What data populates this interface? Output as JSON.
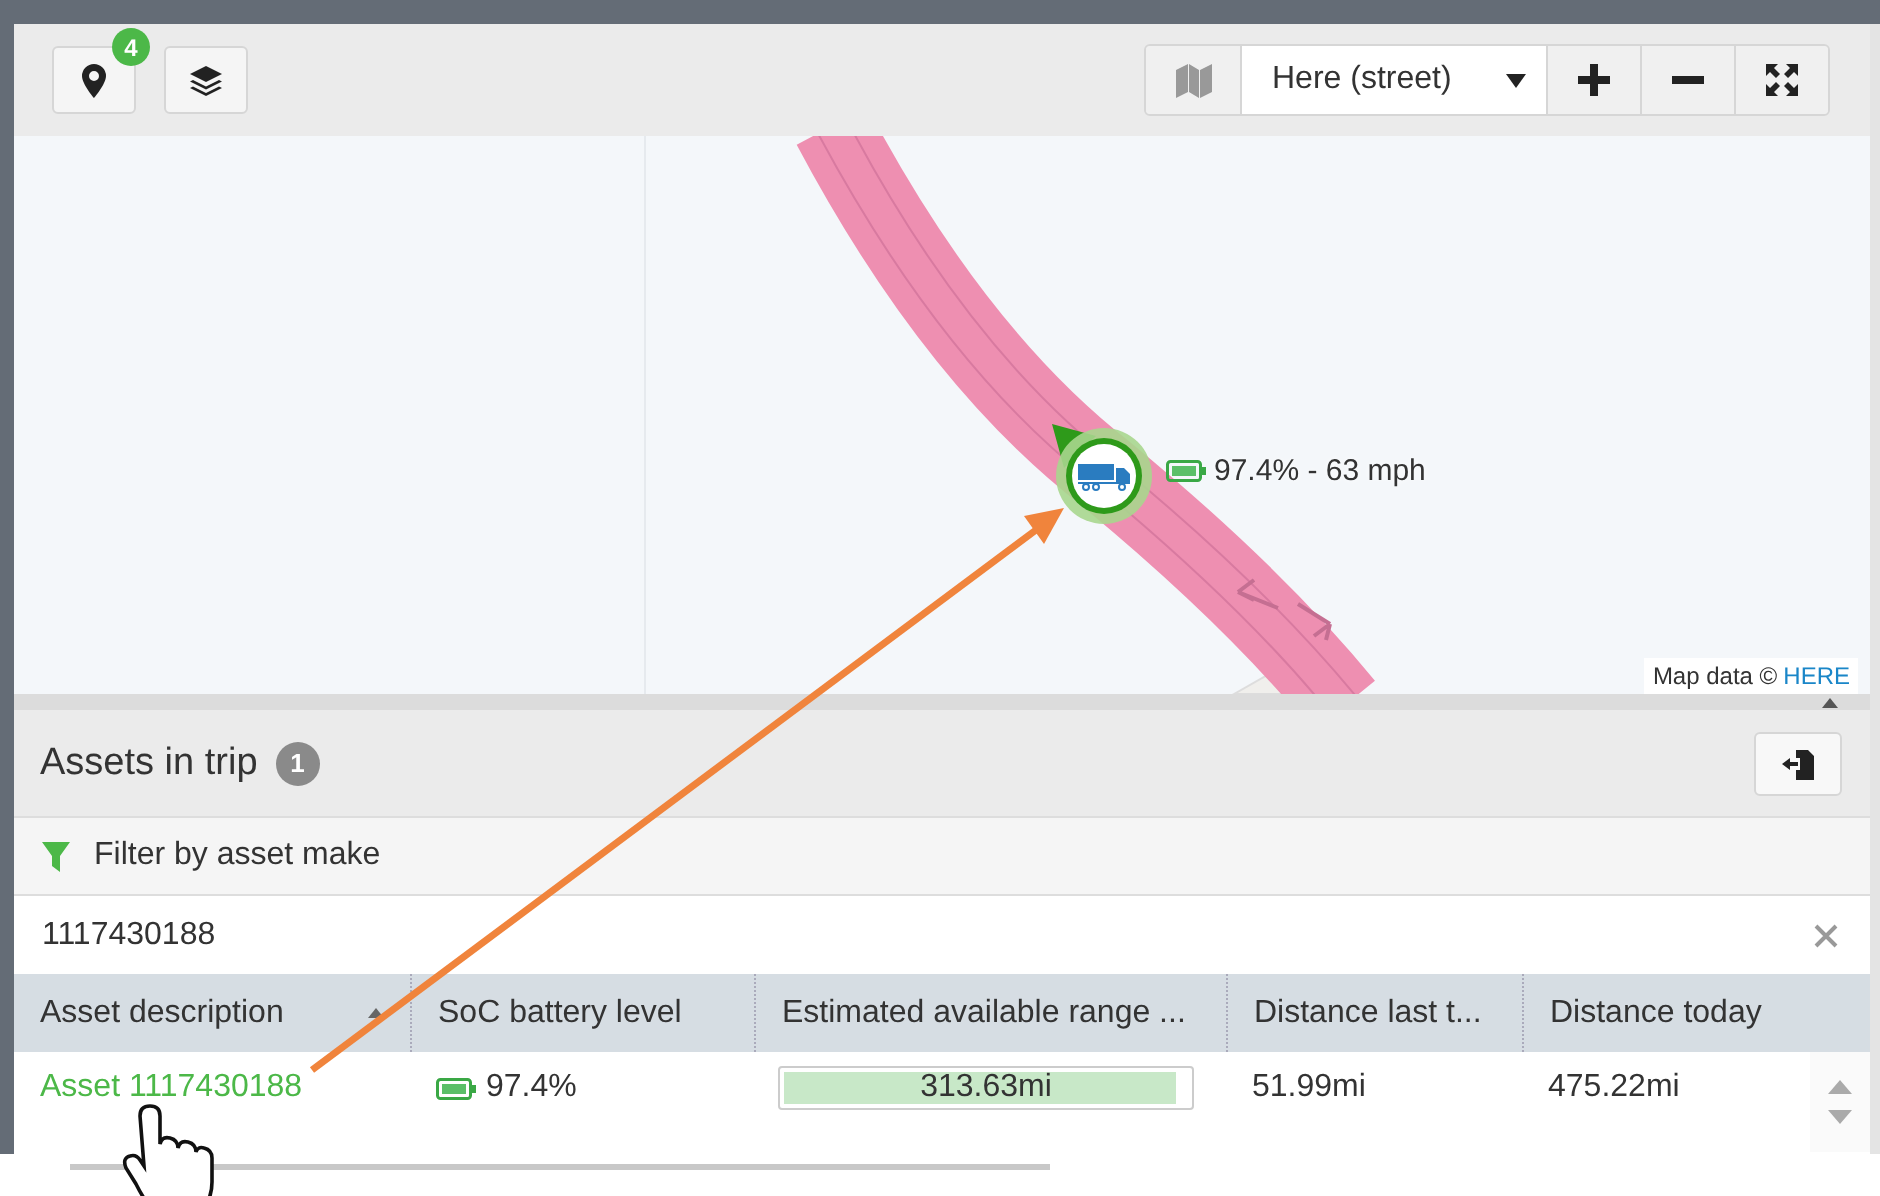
{
  "toolbar": {
    "locations_badge": "4",
    "map_style": "Here (street)"
  },
  "map": {
    "marker_label": "97.4% - 63 mph",
    "attribution": "Map data ©",
    "attribution_link": "HERE"
  },
  "assets_panel": {
    "title": "Assets in trip",
    "count": "1",
    "filter_label": "Filter by asset make",
    "search_value": "1117430188"
  },
  "table": {
    "columns": [
      {
        "label": "Asset description",
        "sorted": true
      },
      {
        "label": "SoC battery level",
        "sorted": false
      },
      {
        "label": "Estimated available range ...",
        "sorted": false
      },
      {
        "label": "Distance last t...",
        "sorted": false
      },
      {
        "label": "Distance today",
        "sorted": false
      }
    ],
    "rows": [
      {
        "asset": "Asset 1117430188",
        "soc": "97.4%",
        "range": {
          "text": "313.63mi",
          "level": 0.97
        },
        "distance_last_trip": "51.99mi",
        "distance_today": "475.22mi"
      }
    ]
  }
}
